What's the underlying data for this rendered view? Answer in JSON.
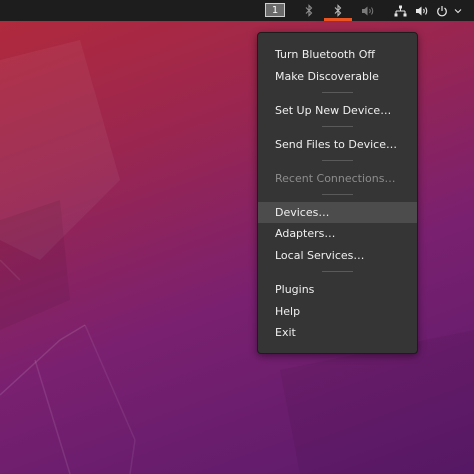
{
  "topbar": {
    "workspace_number": "1",
    "tray_icons": [
      "bluetooth-icon",
      "bluetooth-active-icon",
      "volume-muted-icon",
      "network-icon",
      "volume-icon",
      "power-icon"
    ]
  },
  "menu": {
    "items": [
      {
        "label": "Turn Bluetooth Off"
      },
      {
        "label": "Make Discoverable"
      },
      {
        "label": "Set Up New Device…"
      },
      {
        "label": "Send Files to Device…"
      },
      {
        "label": "Recent Connections…"
      },
      {
        "label": "Devices…"
      },
      {
        "label": "Adapters…"
      },
      {
        "label": "Local Services…"
      },
      {
        "label": "Plugins"
      },
      {
        "label": "Help"
      },
      {
        "label": "Exit"
      }
    ]
  },
  "colors": {
    "accent": "#e95420",
    "menu_bg": "#353535",
    "topbar_bg": "#1d1d1d"
  }
}
